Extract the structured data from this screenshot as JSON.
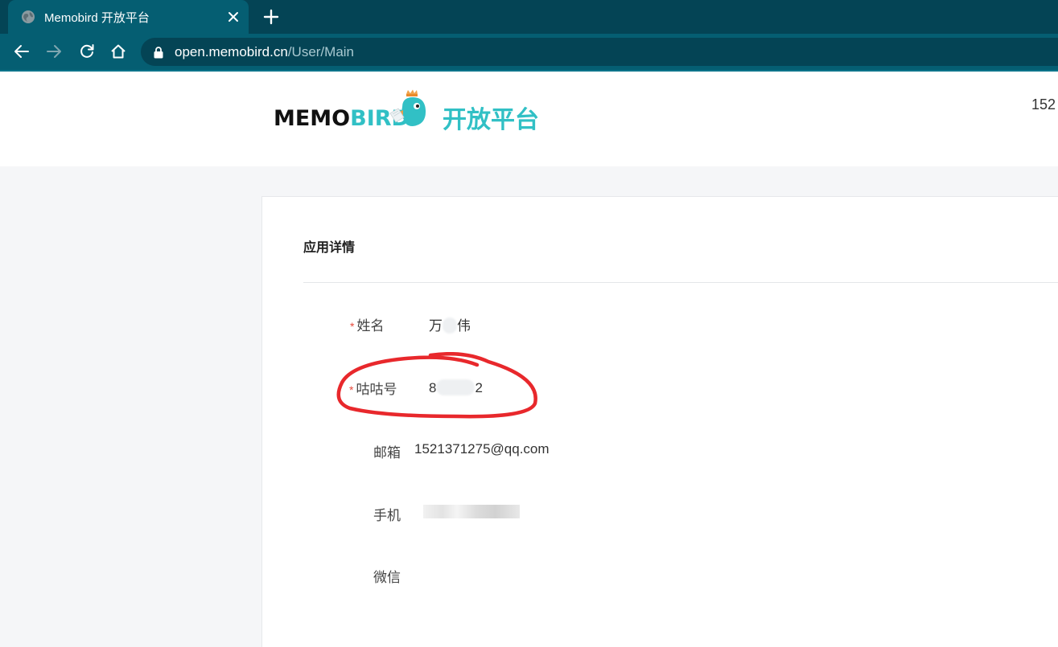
{
  "browser": {
    "tab_title": "Memobird 开放平台",
    "url_host": "open.memobird.cn",
    "url_path": "/User/Main"
  },
  "header": {
    "logo_memo": "MEMO",
    "logo_bird": "BIRD",
    "platform_label": "开放平台",
    "user_snippet": "152"
  },
  "card": {
    "title": "应用详情",
    "fields": [
      {
        "label": "姓名",
        "required": true,
        "value_start": "万",
        "value_end": "伟"
      },
      {
        "label": "咕咕号",
        "required": true,
        "value_start": "8",
        "value_end": "2"
      },
      {
        "label": "邮箱",
        "required": false,
        "value": "1521371275@qq.com"
      },
      {
        "label": "手机",
        "required": false,
        "value": ""
      },
      {
        "label": "微信",
        "required": false,
        "value": ""
      }
    ]
  },
  "colors": {
    "chrome_dark": "#044455",
    "chrome_mid": "#055e72",
    "brand_teal": "#31c0c5",
    "required_red": "#e64a3c",
    "annotation_red": "#e8282c"
  }
}
